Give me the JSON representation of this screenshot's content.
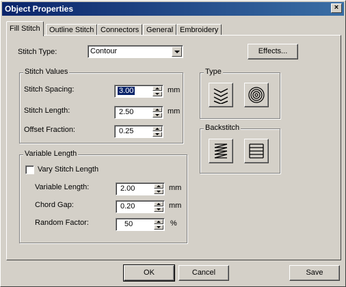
{
  "window": {
    "title": "Object Properties",
    "close_glyph": "×"
  },
  "tabs": [
    {
      "label": "Fill Stitch",
      "active": true
    },
    {
      "label": "Outline Stitch",
      "active": false
    },
    {
      "label": "Connectors",
      "active": false
    },
    {
      "label": "General",
      "active": false
    },
    {
      "label": "Embroidery",
      "active": false
    }
  ],
  "stitch_type": {
    "label": "Stitch Type:",
    "value": "Contour"
  },
  "effects_button": "Effects...",
  "stitch_values": {
    "title": "Stitch Values",
    "spacing": {
      "label": "Stitch Spacing:",
      "value": "3.00",
      "unit": "mm"
    },
    "length": {
      "label": "Stitch Length:",
      "value": "2.50",
      "unit": "mm"
    },
    "offset": {
      "label": "Offset Fraction:",
      "value": "0.25"
    }
  },
  "variable_length": {
    "title": "Variable Length",
    "vary_checkbox": {
      "label": "Vary Stitch Length",
      "checked": false
    },
    "var_length": {
      "label": "Variable Length:",
      "value": "2.00",
      "unit": "mm"
    },
    "chord_gap": {
      "label": "Chord Gap:",
      "value": "0.20",
      "unit": "mm"
    },
    "random_factor": {
      "label": "Random Factor:",
      "value": "50",
      "unit": "%"
    }
  },
  "type_group": {
    "title": "Type",
    "options": [
      {
        "icon": "zigzag-fill-icon",
        "selected": false
      },
      {
        "icon": "concentric-circles-icon",
        "selected": false
      }
    ]
  },
  "backstitch_group": {
    "title": "Backstitch",
    "options": [
      {
        "icon": "diagonal-backstitch-icon",
        "selected": false
      },
      {
        "icon": "straight-backstitch-icon",
        "selected": false
      }
    ]
  },
  "footer": {
    "ok": "OK",
    "cancel": "Cancel",
    "save": "Save"
  }
}
